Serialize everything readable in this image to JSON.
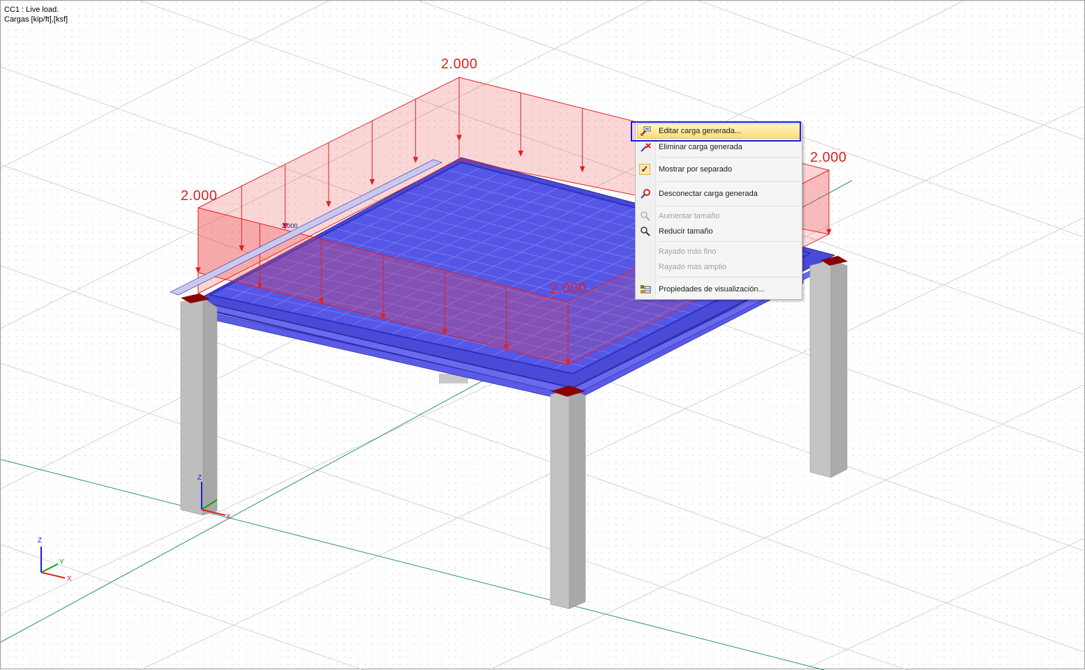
{
  "info": {
    "load_case": "CC1 : Live load.",
    "units": "Cargas [kip/ft],[ksf]"
  },
  "load_labels": {
    "back": "2.000",
    "left": "2.000",
    "right": "2.000",
    "front": "2.000",
    "small": "2.000"
  },
  "axes": {
    "x": "X",
    "y": "Y",
    "z": "Z"
  },
  "context_menu": {
    "items": [
      {
        "label": "Editar carga generada...",
        "icon": "edit-load-icon",
        "enabled": true,
        "highlighted": true
      },
      {
        "label": "Eliminar carga generada",
        "icon": "delete-load-icon",
        "enabled": true
      },
      {
        "label": "Mostrar por separado",
        "icon": "check-icon",
        "enabled": true,
        "checked": true
      },
      {
        "label": "Desconectar carga generada",
        "icon": "disconnect-icon",
        "enabled": true
      },
      {
        "label": "Aumentar tamaño",
        "icon": "zoom-in-icon",
        "enabled": false
      },
      {
        "label": "Reducir tamaño",
        "icon": "zoom-out-icon",
        "enabled": true
      },
      {
        "label": "Rayado más fino",
        "icon": "",
        "enabled": false
      },
      {
        "label": "Rayado más amplio",
        "icon": "",
        "enabled": false
      },
      {
        "label": "Propiedades de visualización...",
        "icon": "display-properties-icon",
        "enabled": true
      }
    ]
  },
  "colors": {
    "slab": "#5050e0",
    "load": "#e02020",
    "column": "#bdbdbd",
    "support": "#8b0000",
    "highlight_border": "#1a1ae0"
  }
}
